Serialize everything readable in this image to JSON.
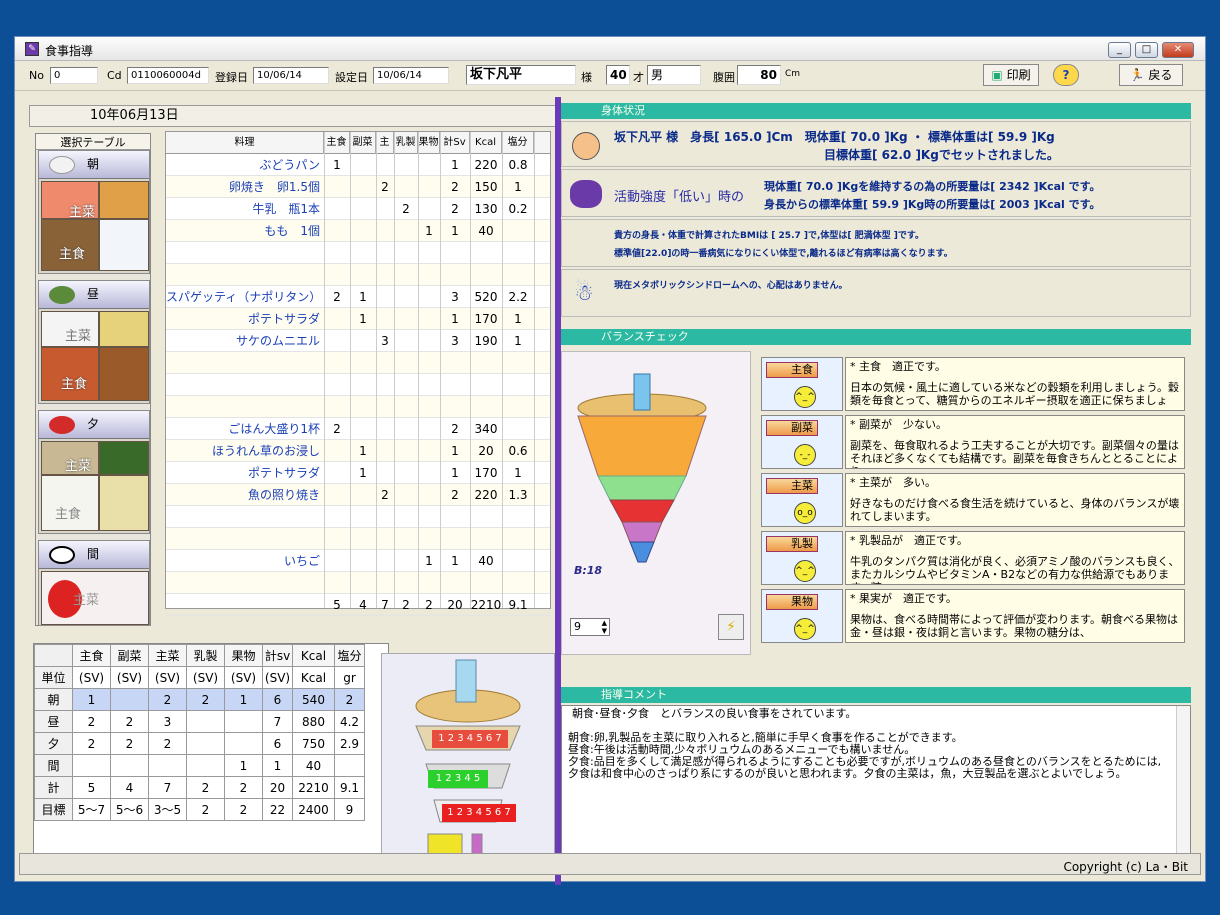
{
  "window": {
    "title": "食事指導"
  },
  "header": {
    "no_label": "No",
    "no_value": "0",
    "cd_label": "Cd",
    "cd_value": "0110060004d",
    "reg_label": "登録日",
    "reg_value": "10/06/14",
    "set_label": "設定日",
    "set_value": "10/06/14",
    "name": "坂下凡平",
    "sama": "様",
    "age": "40",
    "age_unit": "才",
    "sex": "男",
    "waist_label": "腹囲",
    "waist_value": "80",
    "waist_unit": "Cm",
    "print_label": "印刷",
    "help_label": "?",
    "back_label": "戻る"
  },
  "left": {
    "date": "10年06月13日",
    "select_table": "選択テーブル",
    "meals": [
      {
        "label": "朝",
        "tag1": "主菜",
        "tag2": "主食"
      },
      {
        "label": "昼",
        "tag1": "主菜",
        "tag2": "主食"
      },
      {
        "label": "夕",
        "tag1": "主菜",
        "tag2": "主食"
      },
      {
        "label": "間",
        "tag1": "主菜",
        "tag2": ""
      }
    ]
  },
  "food_table": {
    "headers": [
      "料理",
      "主食",
      "副菜",
      "主菜",
      "乳製",
      "果物",
      "計Sv",
      "Kcal",
      "塩分"
    ],
    "rows": [
      [
        "ぶどうパン",
        "1",
        "",
        "",
        "",
        "",
        "1",
        "220",
        "0.8"
      ],
      [
        "卵焼き　卵1.5個",
        "",
        "",
        "2",
        "",
        "",
        "2",
        "150",
        "1"
      ],
      [
        "牛乳　瓶1本",
        "",
        "",
        "",
        "2",
        "",
        "2",
        "130",
        "0.2"
      ],
      [
        "もも　1個",
        "",
        "",
        "",
        "",
        "1",
        "1",
        "40",
        ""
      ],
      [
        "",
        "",
        "",
        "",
        "",
        "",
        "",
        "",
        ""
      ],
      [
        "",
        "",
        "",
        "",
        "",
        "",
        "",
        "",
        ""
      ],
      [
        "スパゲッティ（ナポリタン）",
        "2",
        "1",
        "",
        "",
        "",
        "3",
        "520",
        "2.2"
      ],
      [
        "ポテトサラダ",
        "",
        "1",
        "",
        "",
        "",
        "1",
        "170",
        "1"
      ],
      [
        "サケのムニエル",
        "",
        "",
        "3",
        "",
        "",
        "3",
        "190",
        "1"
      ],
      [
        "",
        "",
        "",
        "",
        "",
        "",
        "",
        "",
        ""
      ],
      [
        "",
        "",
        "",
        "",
        "",
        "",
        "",
        "",
        ""
      ],
      [
        "",
        "",
        "",
        "",
        "",
        "",
        "",
        "",
        ""
      ],
      [
        "ごはん大盛り1杯",
        "2",
        "",
        "",
        "",
        "",
        "2",
        "340",
        ""
      ],
      [
        "ほうれん草のお浸し",
        "",
        "1",
        "",
        "",
        "",
        "1",
        "20",
        "0.6"
      ],
      [
        "ポテトサラダ",
        "",
        "1",
        "",
        "",
        "",
        "1",
        "170",
        "1"
      ],
      [
        "魚の照り焼き",
        "",
        "",
        "2",
        "",
        "",
        "2",
        "220",
        "1.3"
      ],
      [
        "",
        "",
        "",
        "",
        "",
        "",
        "",
        "",
        ""
      ],
      [
        "",
        "",
        "",
        "",
        "",
        "",
        "",
        "",
        ""
      ],
      [
        "いちご",
        "",
        "",
        "",
        "",
        "1",
        "1",
        "40",
        ""
      ],
      [
        "",
        "",
        "",
        "",
        "",
        "",
        "",
        "",
        ""
      ],
      [
        "",
        "5",
        "4",
        "7",
        "2",
        "2",
        "20",
        "2210",
        "9.1"
      ]
    ]
  },
  "summary": {
    "headers": [
      "",
      "主食",
      "副菜",
      "主菜",
      "乳製",
      "果物",
      "計sv",
      "Kcal",
      "塩分"
    ],
    "units": [
      "単位",
      "(SV)",
      "(SV)",
      "(SV)",
      "(SV)",
      "(SV)",
      "(SV)",
      "Kcal",
      "gr"
    ],
    "rows": [
      [
        "朝",
        "1",
        "",
        "2",
        "2",
        "1",
        "6",
        "540",
        "2"
      ],
      [
        "昼",
        "2",
        "2",
        "3",
        "",
        "",
        "7",
        "880",
        "4.2"
      ],
      [
        "夕",
        "2",
        "2",
        "2",
        "",
        "",
        "6",
        "750",
        "2.9"
      ],
      [
        "間",
        "",
        "",
        "",
        "",
        "1",
        "1",
        "40",
        ""
      ],
      [
        "計",
        "5",
        "4",
        "7",
        "2",
        "2",
        "20",
        "2210",
        "9.1"
      ],
      [
        "目標",
        "5〜7",
        "5〜6",
        "3〜5",
        "2",
        "2",
        "22",
        "2400",
        "9"
      ]
    ]
  },
  "body": {
    "section_title": "身体状況",
    "line1": "坂下凡平 様　身長[ 165.0 ]Cm　現体重[ 70.0 ]Kg ・ 標準体重は[ 59.9 ]Kg",
    "line2": "目標体重[ 62.0 ]Kgでセットされました。",
    "activity_label": "活動強度「低い」時の",
    "act1": "現体重[ 70.0 ]Kgを維持するの為の所要量は[ 2342 ]Kcal です。",
    "act2": "身長からの標準体重[ 59.9 ]Kg時の所要量は[ 2003 ]Kcal です。",
    "bmi1": "貴方の身長・体重で計算されたBMIは [ 25.7 ]で,体型は[ 肥満体型 ]です。",
    "bmi2": "標準値[22.0]の時一番病気になりにくい体型で,離れるほど有病率は高くなります。",
    "meta": "現在メタボリックシンドロームへの、心配はありません。"
  },
  "balance": {
    "section_title": "バランスチェック",
    "b_label": "B:18",
    "spin_value": "9",
    "cats": [
      {
        "label": "主食",
        "face": "^_^",
        "text1": "* 主食　適正です。",
        "text2": "日本の気候・風土に適している米などの穀類を利用しましょう。穀類を毎食とって、糖質からのエネルギー摂取を適正に保ちましょ"
      },
      {
        "label": "副菜",
        "face": "-_-",
        "text1": "* 副菜が　少ない。",
        "text2": "副菜を、毎食取れるよう工夫することが大切です。副菜個々の量はそれほど多くなくても結構です。副菜を毎食きちんととることにより、"
      },
      {
        "label": "主菜",
        "face": "o_o",
        "text1": "* 主菜が　多い。",
        "text2": "好きなものだけ食べる食生活を続けていると、身体のバランスが壊れてしまいます。"
      },
      {
        "label": "乳製",
        "face": "^_^",
        "text1": "* 乳製品が　適正です。",
        "text2": "牛乳のタンパク質は消化が良く、必須アミノ酸のバランスも良く、またカルシウムやビタミンA・B2などの有力な供給源でもあります。糖"
      },
      {
        "label": "果物",
        "face": "^_^",
        "text1": "* 果実が　適正です。",
        "text2": "果物は、食べる時間帯によって評価が変わります。朝食べる果物は金・昼は銀・夜は銅と言います。果物の糖分は、"
      }
    ]
  },
  "comment": {
    "section_title": "指導コメント",
    "lines": [
      "朝食･昼食･夕食　とバランスの良い食事をされています。",
      "",
      "朝食:卵,乳製品を主菜に取り入れると,簡単に手早く食事を作ることができます。",
      "昼食:午後は活動時間,少々ボリュウムのあるメニューでも構いません。",
      "夕食:品目を多くして満足感が得られるようにすることも必要ですが,ボリュウムのある昼食とのバランスをとるためには,",
      "夕食は和食中心のさっぱり系にするのが良いと思われます。夕食の主菜は，魚，大豆製品を選ぶとよいでしょう。"
    ]
  },
  "status": {
    "copyright": "Copyright (c)  La・Bit"
  },
  "pyramid_numbers": {
    "row1": "1 2 3 4 5 6 7",
    "row2": "1 2 3 4 5",
    "row3": "1 2 3 4 5 6 7"
  },
  "colors": {
    "accent": "#2bb9a4",
    "splitter": "#6c3ab8",
    "desktop": "#0d4f96"
  }
}
